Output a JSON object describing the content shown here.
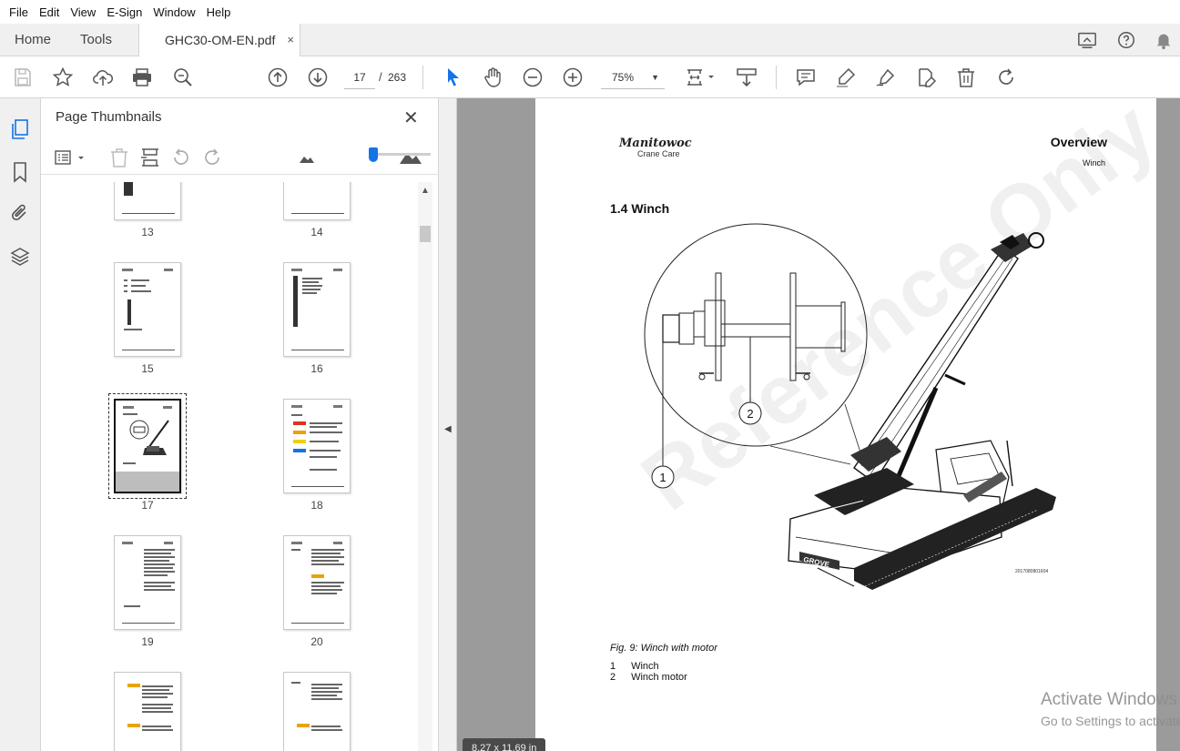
{
  "menu": [
    "File",
    "Edit",
    "View",
    "E-Sign",
    "Window",
    "Help"
  ],
  "tabs": {
    "home": "Home",
    "tools": "Tools",
    "document": "GHC30-OM-EN.pdf",
    "close": "×"
  },
  "toolbar": {
    "current_page": "17",
    "separator": "/",
    "total_pages": "263",
    "zoom": "75%"
  },
  "thumbnails_panel": {
    "title": "Page Thumbnails",
    "close": "✕",
    "pages": [
      "13",
      "14",
      "15",
      "16",
      "17",
      "18",
      "19",
      "20"
    ],
    "selected_page": "17"
  },
  "document": {
    "logo": "Manitowoc",
    "logo_sub": "Crane Care",
    "header_title": "Overview",
    "header_sub": "Winch",
    "section_title": "1.4   Winch",
    "callouts": [
      "1",
      "2"
    ],
    "figure_id": "2017080801604",
    "crane_brand": "GROVE",
    "watermark": "Reference Only",
    "caption": "Fig. 9: Winch with motor",
    "legend": [
      {
        "n": "1",
        "label": "Winch"
      },
      {
        "n": "2",
        "label": "Winch motor"
      }
    ],
    "page_size": "8.27 x 11.69 in"
  },
  "os_overlay": {
    "line1": "Activate Windows",
    "line2": "Go to Settings to activate Windows."
  },
  "colors": {
    "accent": "#1473e6",
    "chrome_bg": "#f0f0f0",
    "doc_bg": "#9b9b9b"
  }
}
